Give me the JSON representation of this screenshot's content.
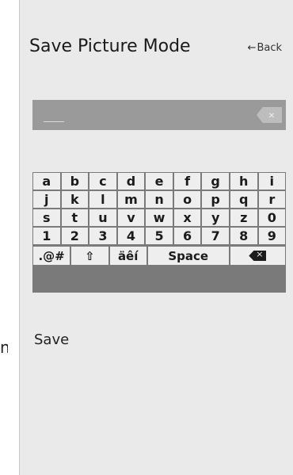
{
  "edge_char": "n",
  "header": {
    "title": "Save Picture Mode",
    "back_label": "Back",
    "back_arrow": "←"
  },
  "input": {
    "value": "",
    "clear_glyph": "×"
  },
  "keyboard": {
    "rows": [
      [
        "a",
        "b",
        "c",
        "d",
        "e",
        "f",
        "g",
        "h",
        "i"
      ],
      [
        "j",
        "k",
        "l",
        "m",
        "n",
        "o",
        "p",
        "q",
        "r"
      ],
      [
        "s",
        "t",
        "u",
        "v",
        "w",
        "x",
        "y",
        "z",
        "0"
      ],
      [
        "1",
        "2",
        "3",
        "4",
        "5",
        "6",
        "7",
        "8",
        "9"
      ]
    ],
    "special": {
      "symbols": ".@#",
      "shift": "⇧",
      "accents": "äêí",
      "space": "Space",
      "backspace_glyph": "×"
    }
  },
  "save_label": "Save"
}
